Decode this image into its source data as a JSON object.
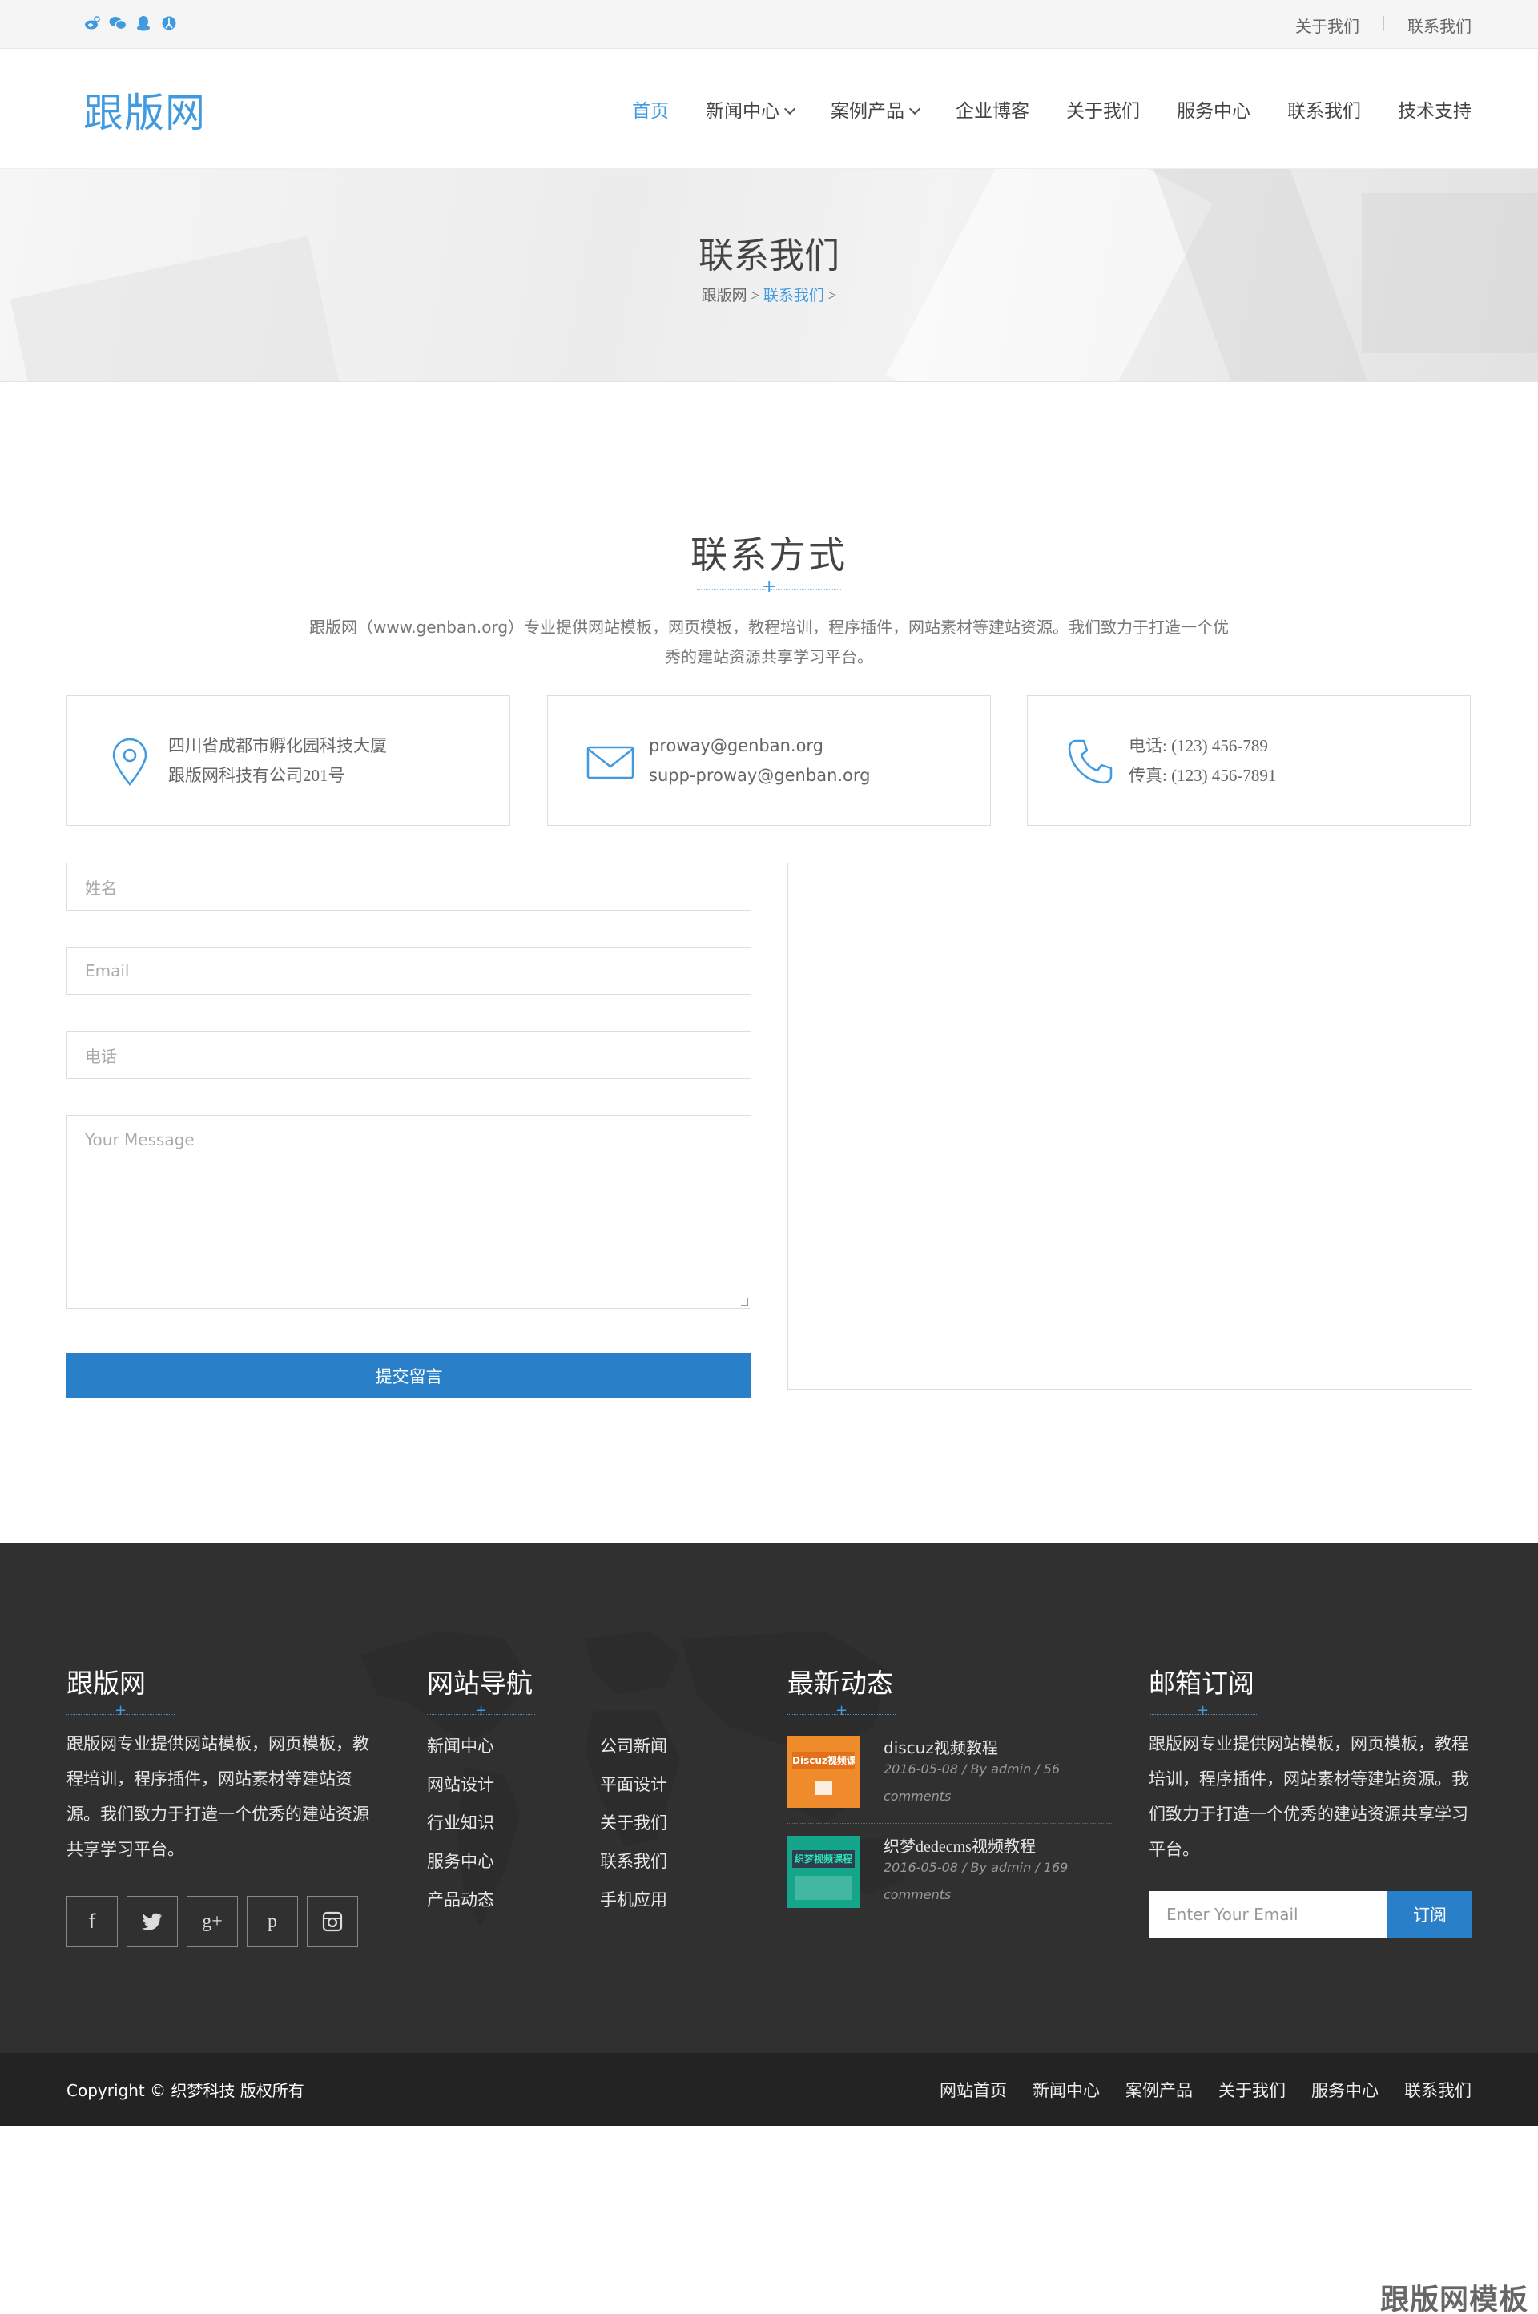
{
  "topbar": {
    "about": "关于我们",
    "separator": "|",
    "contact": "联系我们"
  },
  "header": {
    "logo": "跟版网",
    "nav": [
      "首页",
      "新闻中心",
      "案例产品",
      "企业博客",
      "关于我们",
      "服务中心",
      "联系我们",
      "技术支持"
    ]
  },
  "banner": {
    "title": "联系我们",
    "crumb_home": "跟版网",
    "crumb_sep1": " > ",
    "crumb_current": "联系我们",
    "crumb_sep2": " >"
  },
  "section": {
    "title": "联系方式",
    "intro": "跟版网（www.genban.org）专业提供网站模板，网页模板，教程培训，程序插件，网站素材等建站资源。我们致力于打造一个优秀的建站资源共享学习平台。"
  },
  "cards": [
    {
      "line1": "四川省成都市孵化园科技大厦",
      "line2": "跟版网科技有公司201号"
    },
    {
      "line1": "proway@genban.org",
      "line2": "supp-proway@genban.org"
    },
    {
      "line1": "电话: (123) 456-789",
      "line2": "传真: (123) 456-7891"
    }
  ],
  "form": {
    "name_placeholder": "姓名",
    "email_placeholder": "Email",
    "phone_placeholder": "电话",
    "message_placeholder": "Your Message",
    "submit": "提交留言"
  },
  "footer": {
    "about": {
      "title": "跟版网",
      "text": "跟版网专业提供网站模板，网页模板，教程培训，程序插件，网站素材等建站资源。我们致力于打造一个优秀的建站资源共享学习平台。"
    },
    "nav": {
      "title": "网站导航",
      "col1": [
        "新闻中心",
        "网站设计",
        "行业知识",
        "服务中心",
        "产品动态"
      ],
      "col2": [
        "公司新闻",
        "平面设计",
        "关于我们",
        "联系我们",
        "手机应用"
      ]
    },
    "news": {
      "title": "最新动态",
      "posts": [
        {
          "title": "discuz视频教程",
          "meta1": "2016-05-08  /  By admin  /  56",
          "meta2": "comments",
          "thumb": "Discuz视频课程"
        },
        {
          "title": "织梦dedecms视频教程",
          "meta1": "2016-05-08  /  By admin  /  169",
          "meta2": "comments",
          "thumb": "织梦视频课程"
        }
      ]
    },
    "subscribe": {
      "title": "邮箱订阅",
      "text": "跟版网专业提供网站模板，网页模板，教程培训，程序插件，网站素材等建站资源。我们致力于打造一个优秀的建站资源共享学习平台。",
      "placeholder": "Enter Your Email",
      "button": "订阅"
    },
    "social_icons": [
      "facebook-icon",
      "twitter-icon",
      "google-plus-icon",
      "pinterest-icon",
      "instagram-icon"
    ]
  },
  "bottom": {
    "copyright": "Copyright © 织梦科技 版权所有",
    "links": [
      "网站首页",
      "新闻中心",
      "案例产品",
      "关于我们",
      "服务中心",
      "联系我们"
    ]
  },
  "watermark": "跟版网模板",
  "colors": {
    "accent": "#3f9ae0",
    "button": "#2a7fc9",
    "footer_bg": "#303030",
    "bottom_bg": "#232323"
  }
}
